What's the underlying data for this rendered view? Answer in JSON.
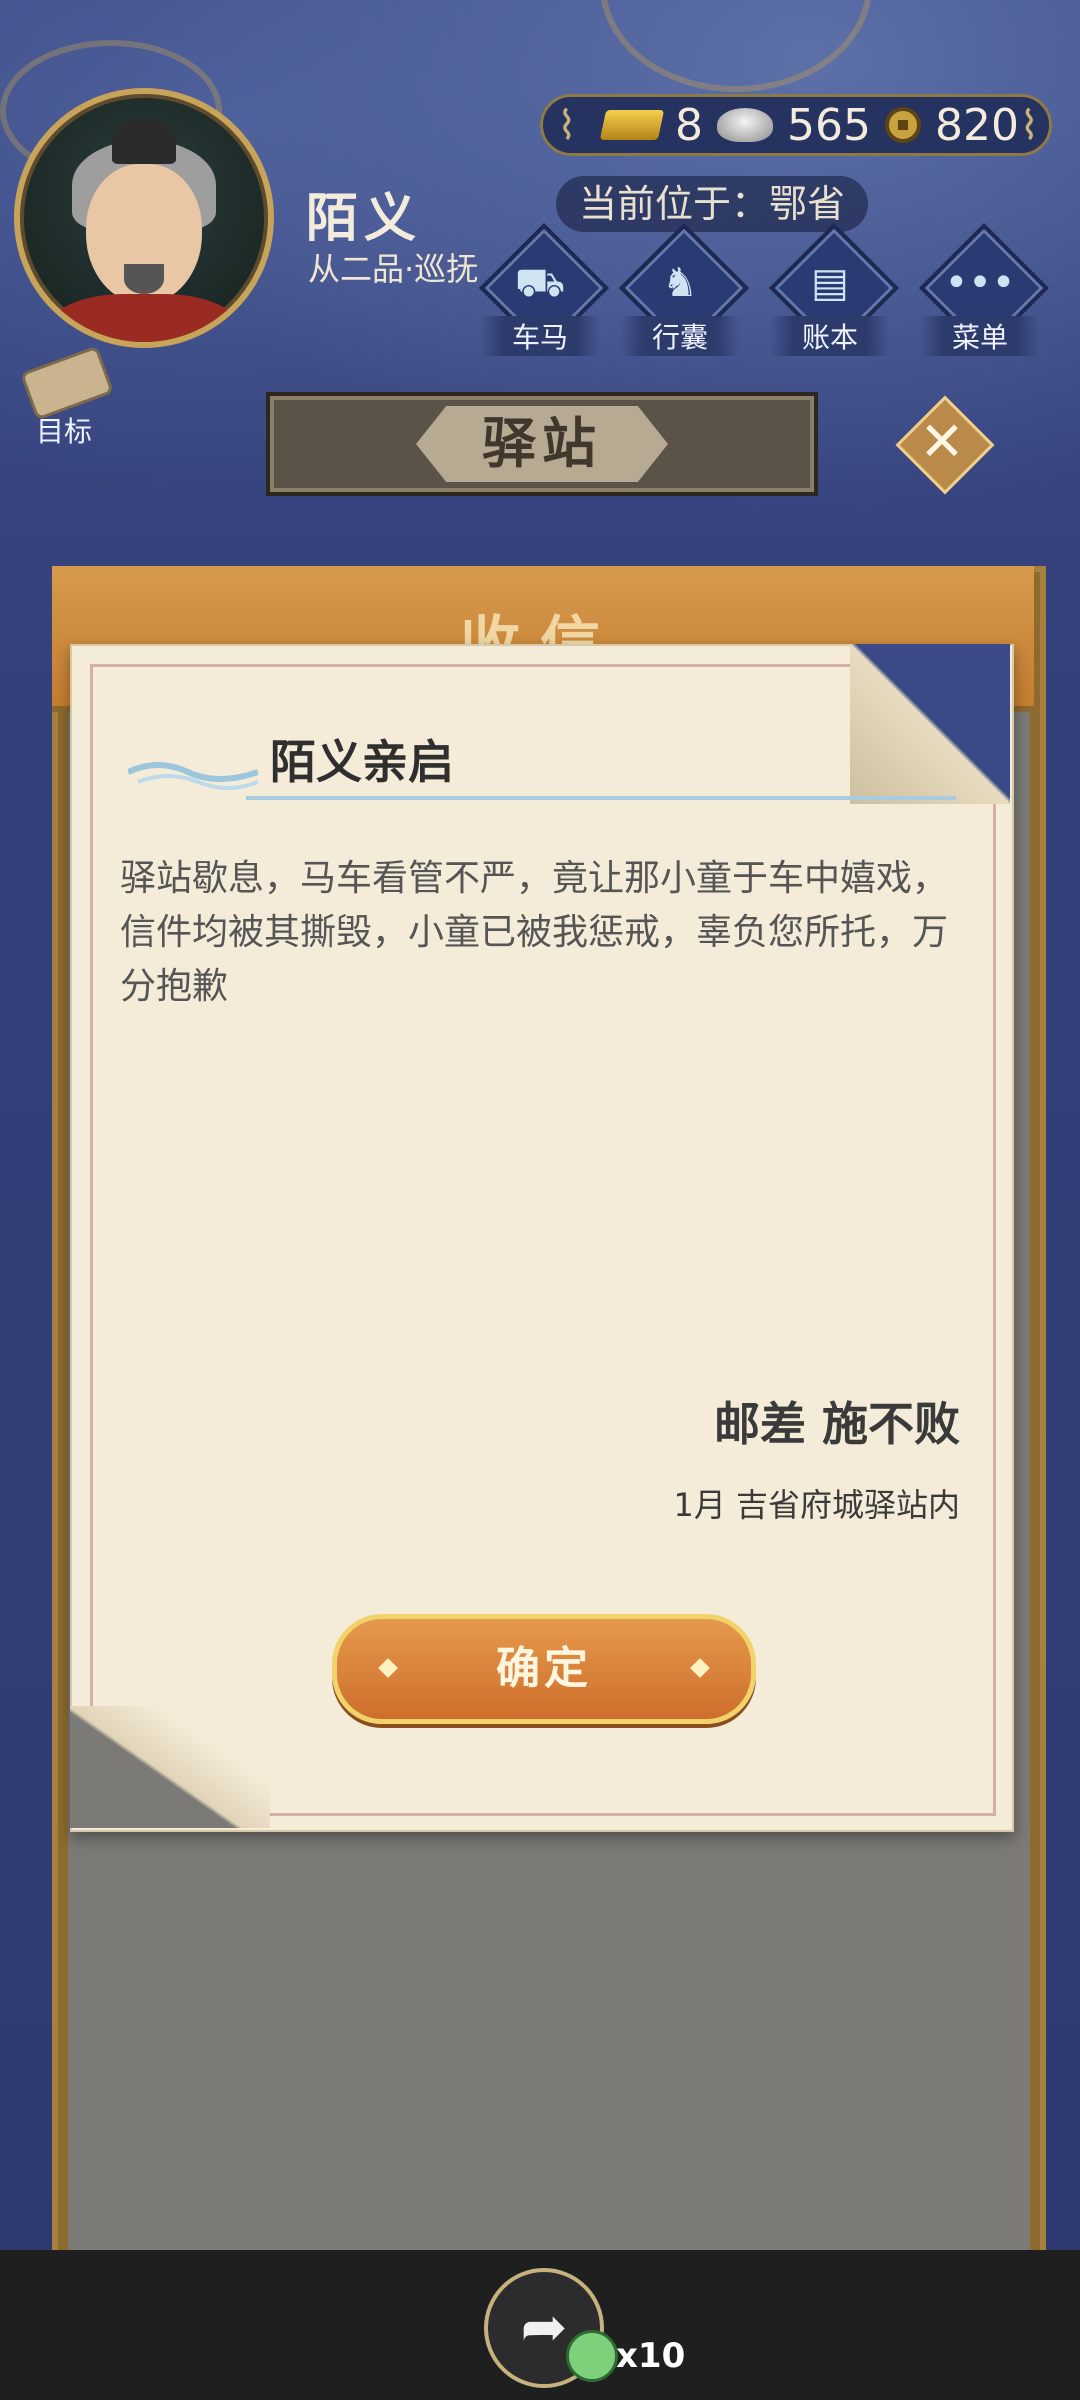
{
  "header": {
    "player_name": "陌义",
    "rank": "从二品·巡抚",
    "location": "当前位于：鄂省",
    "currency": [
      {
        "name": "gold-bar",
        "value": "8"
      },
      {
        "name": "silver-ingot",
        "value": "565"
      },
      {
        "name": "copper-coin",
        "value": "820"
      }
    ],
    "menu": [
      {
        "label": "车马",
        "icon": "carriage-icon"
      },
      {
        "label": "行囊",
        "icon": "bag-icon"
      },
      {
        "label": "账本",
        "icon": "ledger-icon"
      },
      {
        "label": "菜单",
        "icon": "more-icon"
      }
    ],
    "goal_label": "目标"
  },
  "banner": {
    "title": "驿站"
  },
  "panel": {
    "title": "收信"
  },
  "letter": {
    "title": "陌义亲启",
    "body": "驿站歇息，马车看管不严，竟让那小童于车中嬉戏，信件均被其撕毁，小童已被我惩戒，辜负您所托，万分抱歉",
    "signer": "邮差 施不败",
    "place": "1月 吉省府城驿站内",
    "confirm_label": "确定"
  },
  "bottom": {
    "gift_count": "x10"
  },
  "colors": {
    "accent_gold": "#c8a35a",
    "button_orange": "#cf6e2c",
    "paper": "#f4ecd8"
  }
}
